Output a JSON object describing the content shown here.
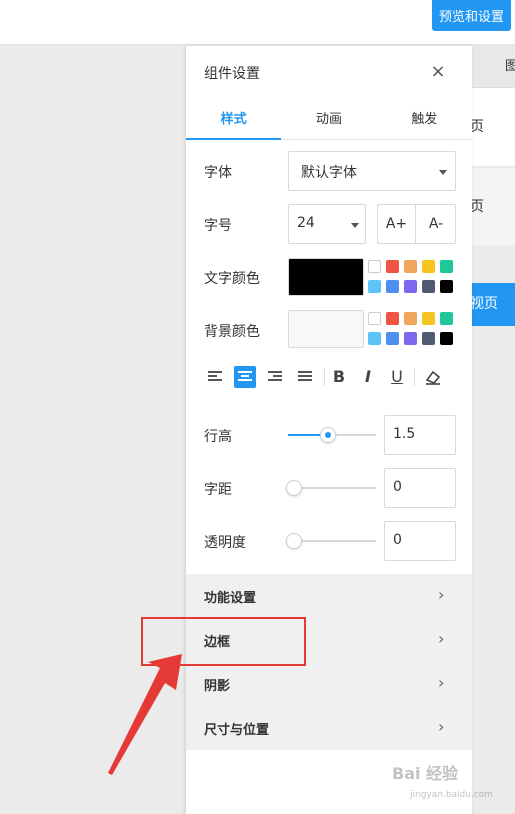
{
  "topbar": {
    "preview_button": "预览和设置"
  },
  "background": {
    "tab_partial": "图",
    "card1_partial": "页",
    "card2_partial": "页",
    "blue_button_partial": "视页"
  },
  "panel": {
    "title": "组件设置",
    "close": "×",
    "tabs": [
      {
        "label": "样式",
        "active": true
      },
      {
        "label": "动画",
        "active": false
      },
      {
        "label": "触发",
        "active": false
      }
    ],
    "font": {
      "label": "字体",
      "value": "默认字体"
    },
    "font_size": {
      "label": "字号",
      "value": "24",
      "increase": "A+",
      "decrease": "A-"
    },
    "text_color": {
      "label": "文字颜色",
      "value": "#000000"
    },
    "bg_color": {
      "label": "背景颜色",
      "value": "#f7f8fa"
    },
    "palette": [
      "#ffffff",
      "#f05544",
      "#f0a55a",
      "#f7c522",
      "#1fc89a",
      "#5ec3f7",
      "#4f8ff0",
      "#7b68ee",
      "#505a74",
      "#000000"
    ],
    "format": {
      "bold": "B",
      "italic": "I",
      "underline": "U"
    },
    "line_height": {
      "label": "行高",
      "value": "1.5",
      "fraction": 0.45
    },
    "letter_spacing": {
      "label": "字距",
      "value": "0",
      "fraction": 0.0
    },
    "opacity": {
      "label": "透明度",
      "value": "0",
      "fraction": 0.0
    },
    "sections": [
      {
        "label": "功能设置"
      },
      {
        "label": "边框"
      },
      {
        "label": "阴影"
      },
      {
        "label": "尺寸与位置"
      }
    ]
  },
  "watermark": {
    "main": "Bai 经验",
    "sub": "jingyan.baidu.com"
  }
}
